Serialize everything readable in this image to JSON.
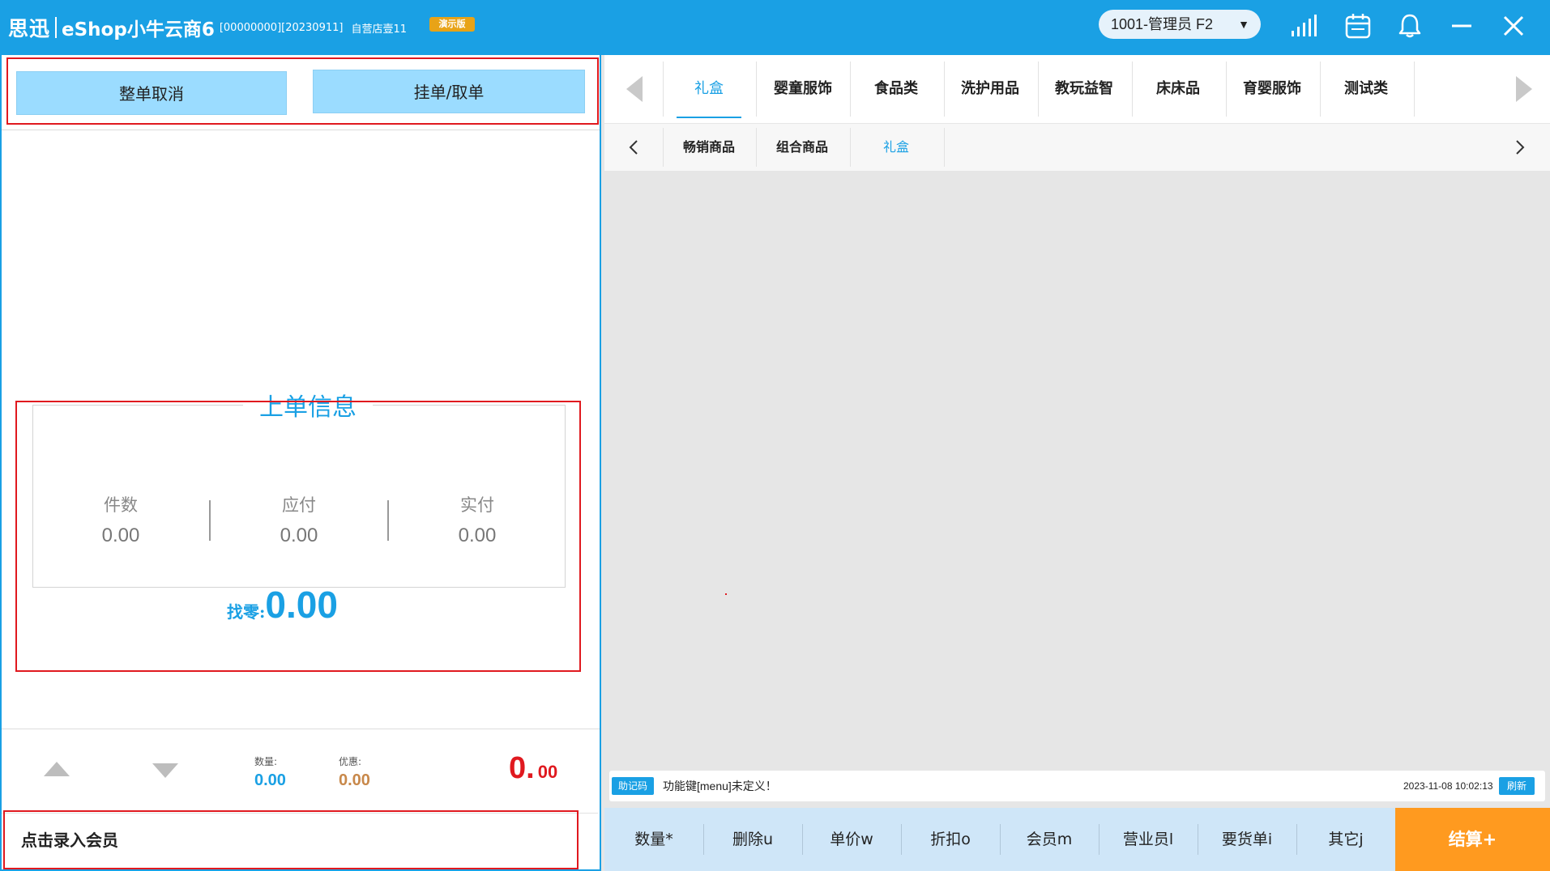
{
  "titlebar": {
    "logo": "思迅",
    "app_name": "eShop小牛云商6",
    "code": "[00000000][20230911]",
    "store": "自营店壹11",
    "badge": "演示版",
    "user": "1001-管理员 F2"
  },
  "left": {
    "cancel_label": "整单取消",
    "hold_label": "挂单/取单",
    "last_order": {
      "title": "上单信息",
      "count_label": "件数",
      "count_value": "0.00",
      "payable_label": "应付",
      "payable_value": "0.00",
      "paid_label": "实付",
      "paid_value": "0.00",
      "change_label": "找零:",
      "change_value": "0.00"
    },
    "summary": {
      "qty_label": "数量:",
      "qty_value": "0.00",
      "discount_label": "优惠:",
      "discount_value": "0.00",
      "total_int": "0.",
      "total_dec": "00"
    },
    "member_label": "点击录入会员"
  },
  "categories": [
    "礼盒",
    "婴童服饰",
    "食品类",
    "洗护用品",
    "教玩益智",
    "床床品",
    "育婴服饰",
    "测试类"
  ],
  "subcategories": [
    "畅销商品",
    "组合商品",
    "礼盒"
  ],
  "status": {
    "tag": "助记码",
    "message": "功能键[menu]未定义！",
    "time": "2023-11-08 10:02:13",
    "refresh": "刷新"
  },
  "functions": [
    "数量*",
    "删除u",
    "单价w",
    "折扣o",
    "会员m",
    "营业员l",
    "要货单i",
    "其它j"
  ],
  "checkout_label": "结算+",
  "colors": {
    "accent": "#1aa0e4",
    "checkout": "#ff9a1f",
    "highlight_box": "#e0191f",
    "button_light": "#9bdcff",
    "total": "#e0191f",
    "discount": "#c8884a"
  },
  "icons": [
    "signal-icon",
    "calendar-icon",
    "bell-icon",
    "minimize-icon",
    "close-icon"
  ]
}
